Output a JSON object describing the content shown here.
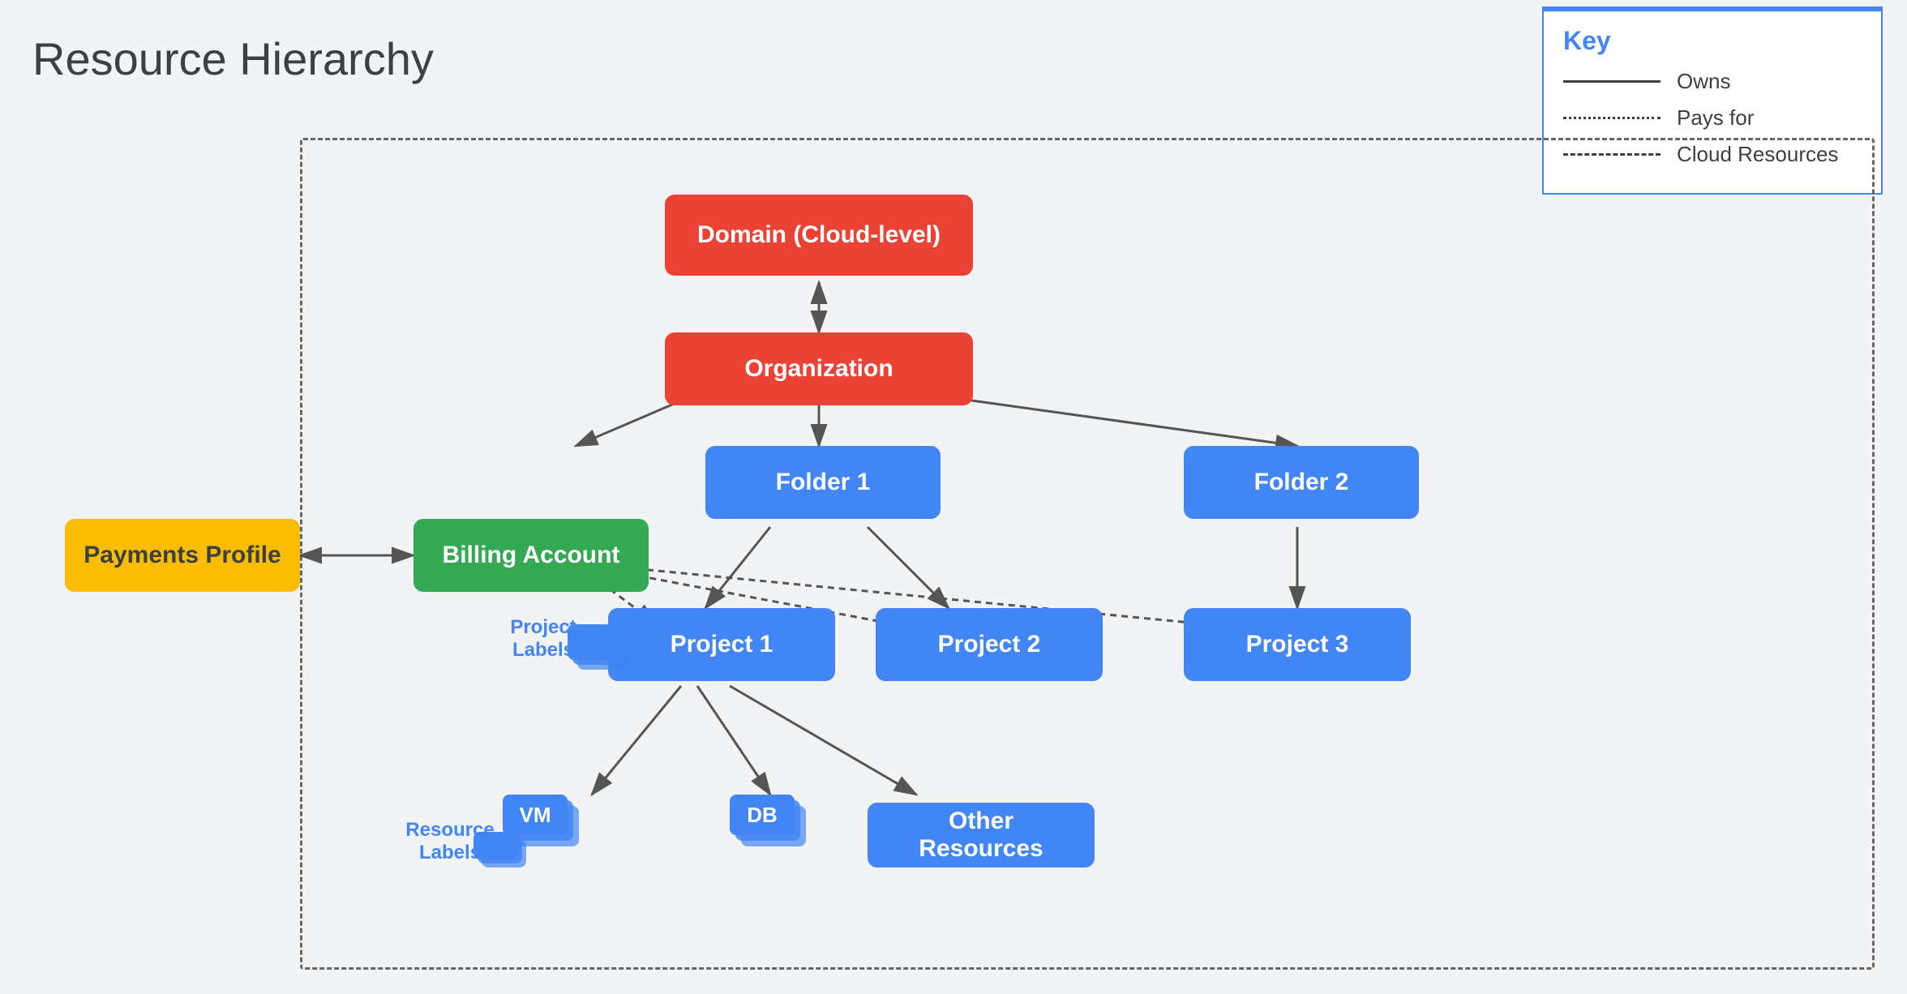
{
  "title": "Resource Hierarchy",
  "key": {
    "title": "Key",
    "items": [
      {
        "line_type": "solid",
        "label": "Owns"
      },
      {
        "line_type": "dotted",
        "label": "Pays for"
      },
      {
        "line_type": "dashed",
        "label": "Cloud Resources"
      }
    ]
  },
  "nodes": {
    "domain": "Domain (Cloud-level)",
    "organization": "Organization",
    "billing_account": "Billing Account",
    "payments_profile": "Payments Profile",
    "folder1": "Folder 1",
    "folder2": "Folder 2",
    "project1": "Project 1",
    "project2": "Project 2",
    "project3": "Project 3",
    "vm": "VM",
    "db": "DB",
    "other_resources": "Other Resources"
  },
  "labels": {
    "project_labels": "Project\nLabels",
    "resource_labels": "Resource\nLabels"
  }
}
